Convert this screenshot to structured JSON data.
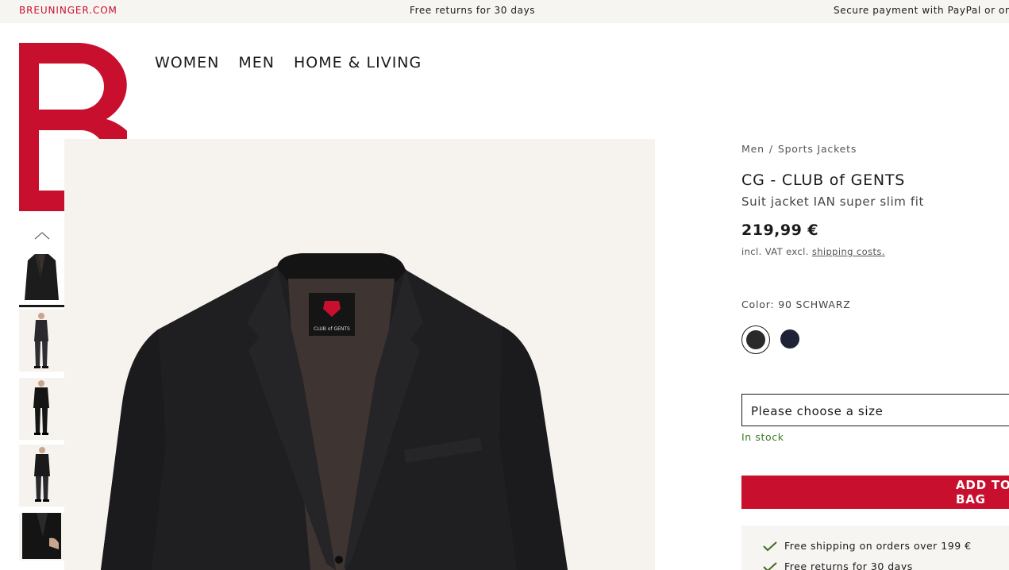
{
  "topbar": {
    "brand": "BREUNINGER.COM",
    "promos": [
      "Free returns for 30 days",
      "Secure payment with PayPal or on account"
    ]
  },
  "logo": {
    "icon": "breuninger-b-logo",
    "color": "#c8102e"
  },
  "nav": {
    "items": [
      "WOMEN",
      "MEN",
      "HOME & LIVING"
    ]
  },
  "gallery": {
    "thumbnails": [
      "jacket-front",
      "model-full-front",
      "model-full-front-2",
      "model-side",
      "detail-closeup"
    ],
    "active_index": 0
  },
  "breadcrumb": {
    "items": [
      "Men",
      "Sports Jackets"
    ],
    "separator": "/"
  },
  "product": {
    "brand": "CG - CLUB of GENTS",
    "name": "Suit jacket IAN super slim fit",
    "price": "219,99 €",
    "vat_prefix": "incl. VAT excl.",
    "shipping_link": "shipping costs."
  },
  "color": {
    "label": "Color: 90 SCHWARZ",
    "swatches": [
      {
        "name": "schwarz",
        "hex": "#2a2a2a",
        "selected": true
      },
      {
        "name": "navy",
        "hex": "#1e2236",
        "selected": false
      }
    ]
  },
  "size": {
    "placeholder": "Please choose a size"
  },
  "stock": "In stock",
  "cart": {
    "add_label": "ADD TO BAG"
  },
  "benefits": [
    "Free shipping on orders over 199 €",
    "Free returns for 30 days"
  ],
  "colors": {
    "accent": "#c8102e",
    "stock": "#3d7a23",
    "check": "#3d6b1e"
  }
}
